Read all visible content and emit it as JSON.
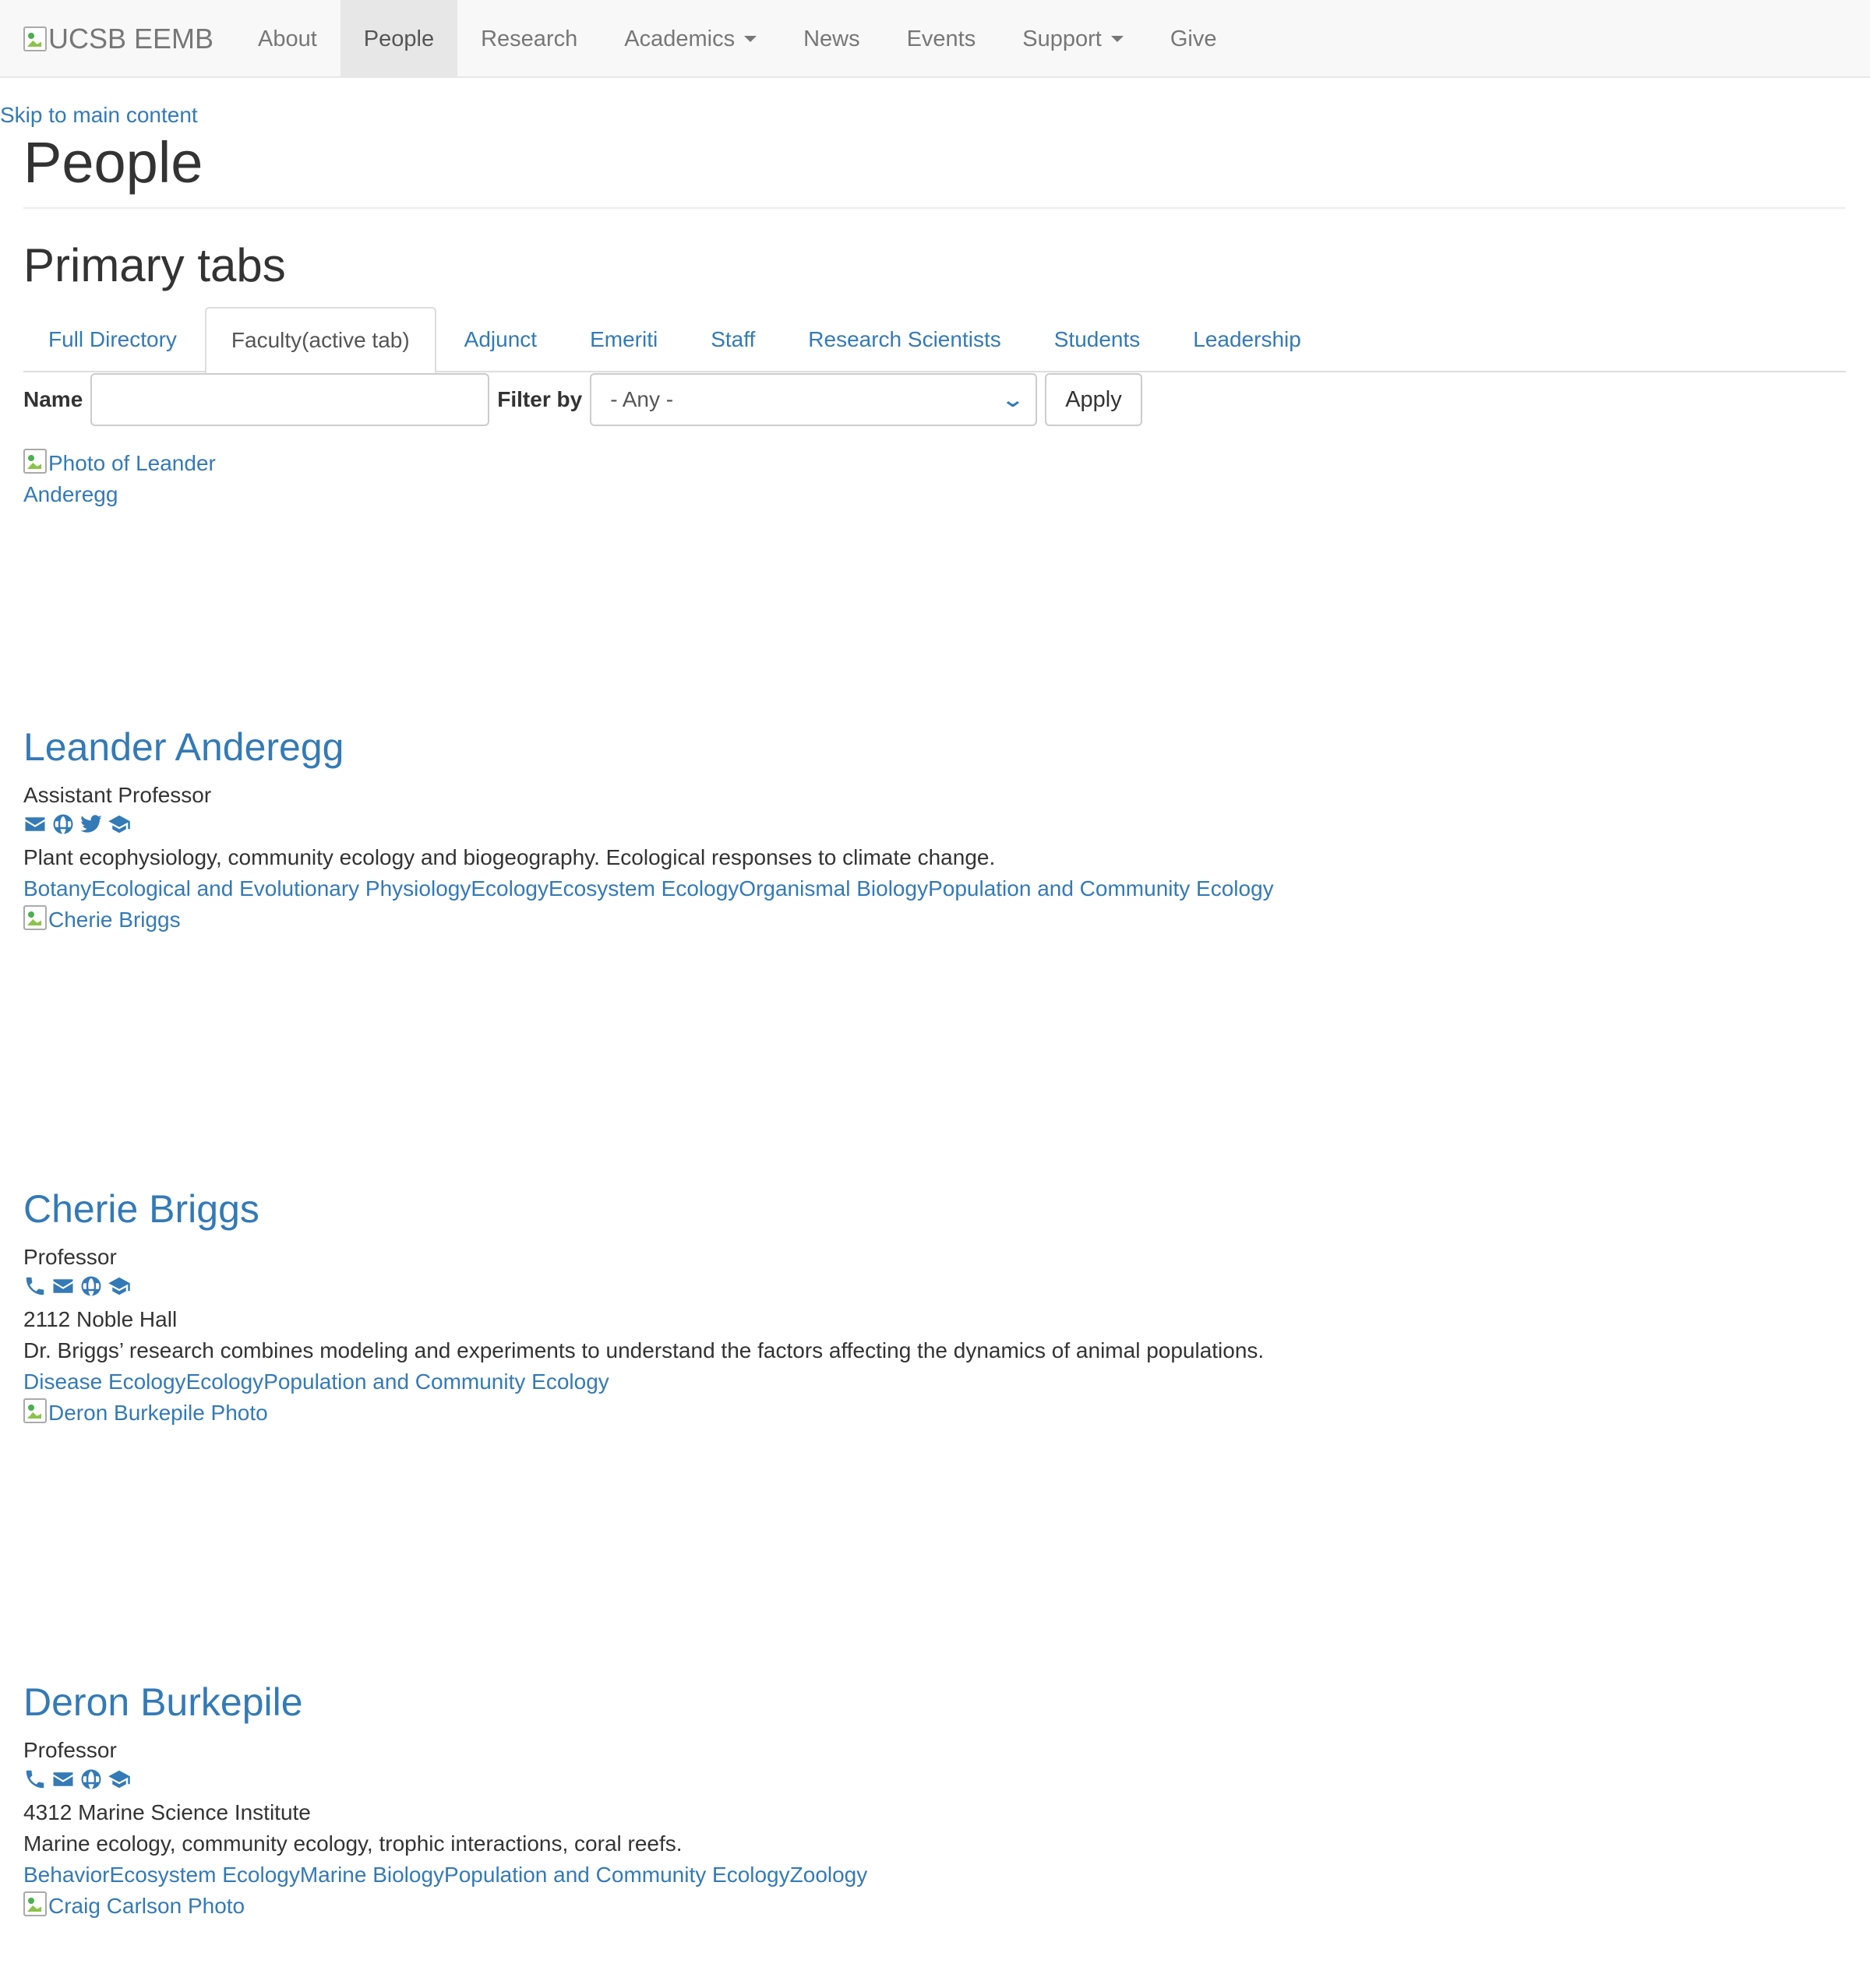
{
  "nav": {
    "brand_alt": "UCSB EEMB",
    "items": [
      {
        "label": "About"
      },
      {
        "label": "People"
      },
      {
        "label": "Research"
      },
      {
        "label": "Academics"
      },
      {
        "label": "News"
      },
      {
        "label": "Events"
      },
      {
        "label": "Support"
      },
      {
        "label": "Give"
      }
    ]
  },
  "skip_link": "Skip to main content",
  "page_title": "People",
  "tabs_heading": "Primary tabs",
  "tabs": [
    {
      "label": "Full Directory"
    },
    {
      "label": "Faculty(active tab)"
    },
    {
      "label": "Adjunct"
    },
    {
      "label": "Emeriti"
    },
    {
      "label": "Staff"
    },
    {
      "label": "Research Scientists"
    },
    {
      "label": "Students"
    },
    {
      "label": "Leadership"
    }
  ],
  "filter": {
    "name_label": "Name",
    "name_value": "",
    "filter_label": "Filter by",
    "filter_value": "- Any -",
    "apply_label": "Apply"
  },
  "people": [
    {
      "photo_alt": "Photo of Leander Anderegg",
      "name": "Leander Anderegg",
      "title": "Assistant Professor",
      "icons": [
        "email-icon",
        "globe-icon",
        "twitter-icon",
        "graduation-cap-icon"
      ],
      "address": "",
      "description": "Plant ecophysiology, community ecology and biogeography. Ecological responses to climate change.",
      "tags": [
        "Botany",
        "Ecological and Evolutionary Physiology",
        "Ecology",
        "Ecosystem Ecology",
        "Organismal Biology",
        "Population and Community Ecology"
      ]
    },
    {
      "photo_alt": "Cherie Briggs",
      "name": "Cherie Briggs",
      "title": "Professor",
      "icons": [
        "phone-icon",
        "email-icon",
        "globe-icon",
        "graduation-cap-icon"
      ],
      "address": "2112 Noble Hall",
      "description": "Dr. Briggs’ research combines modeling and experiments to understand the factors affecting the dynamics of animal populations.",
      "tags": [
        "Disease Ecology",
        "Ecology",
        "Population and Community Ecology"
      ]
    },
    {
      "photo_alt": "Deron Burkepile Photo",
      "name": "Deron Burkepile",
      "title": "Professor",
      "icons": [
        "phone-icon",
        "email-icon",
        "globe-icon",
        "graduation-cap-icon"
      ],
      "address": "4312 Marine Science Institute",
      "description": "Marine ecology, community ecology, trophic interactions, coral reefs.",
      "tags": [
        "Behavior",
        "Ecosystem Ecology",
        "Marine Biology",
        "Population and Community Ecology",
        "Zoology"
      ]
    },
    {
      "photo_alt": "Craig Carlson Photo"
    }
  ]
}
